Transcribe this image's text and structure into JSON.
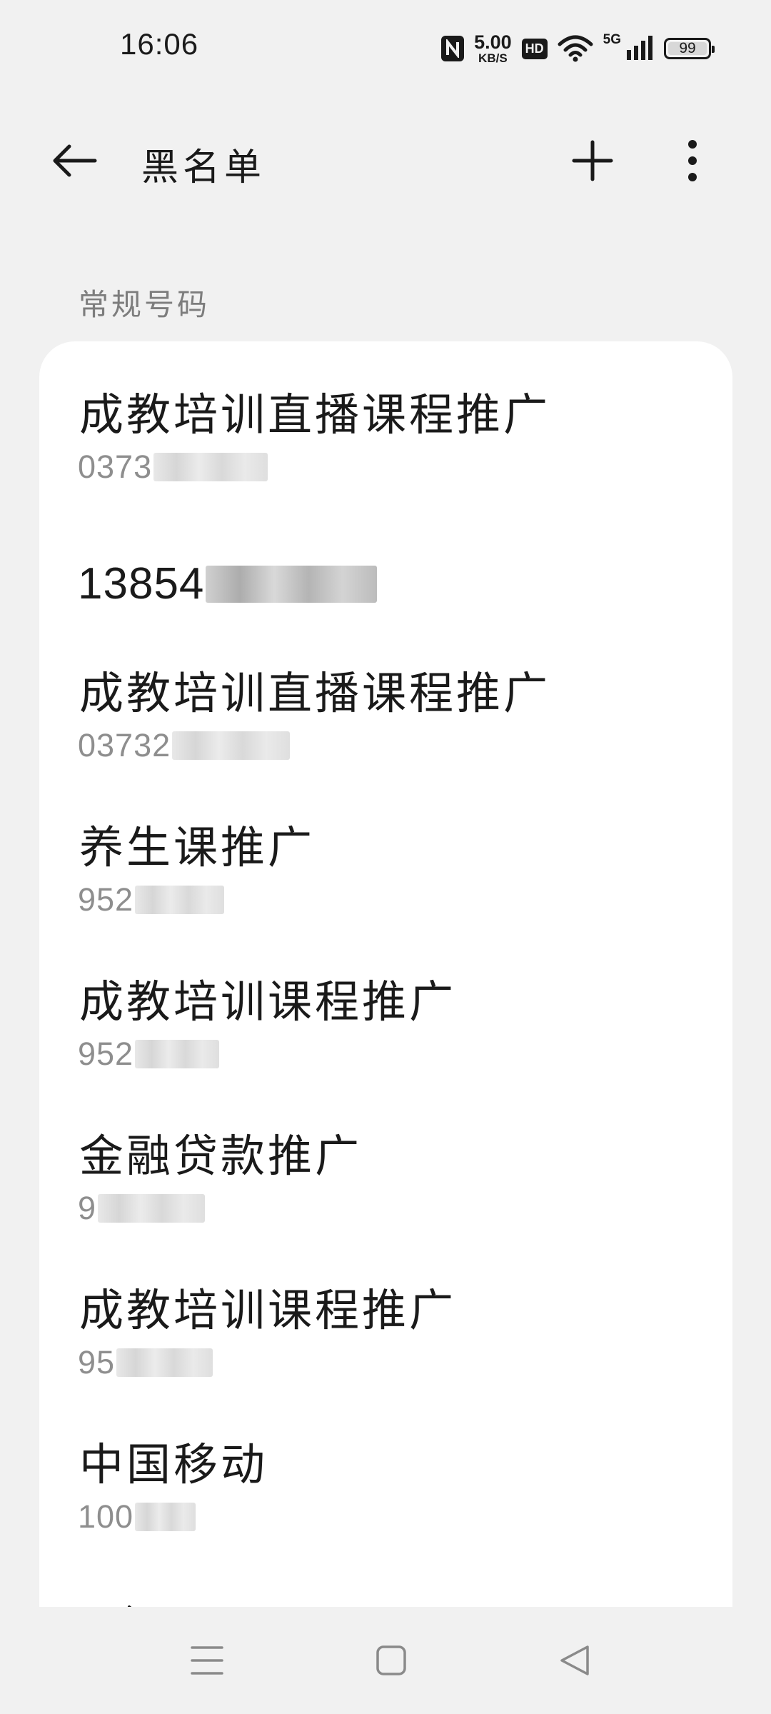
{
  "status_bar": {
    "time": "16:06",
    "net_speed_value": "5.00",
    "net_speed_unit": "KB/S",
    "hd_label": "HD",
    "signal_label": "5G",
    "battery_level": "99"
  },
  "app_bar": {
    "title": "黑名单"
  },
  "section": {
    "header": "常规号码"
  },
  "items": [
    {
      "name": "成教培训直播课程推广",
      "number_visible": "0373"
    },
    {
      "name": "",
      "number_visible": "13854"
    },
    {
      "name": "成教培训直播课程推广",
      "number_visible": "03732"
    },
    {
      "name": "养生课推广",
      "number_visible": "952"
    },
    {
      "name": "成教培训课程推广",
      "number_visible": "952"
    },
    {
      "name": "金融贷款推广",
      "number_visible": "9"
    },
    {
      "name": "成教培训课程推广",
      "number_visible": "95"
    },
    {
      "name": "中国移动",
      "number_visible": "100"
    }
  ],
  "icons": {
    "back": "arrow-left-icon",
    "add": "plus-icon",
    "more": "more-vertical-icon",
    "nav_menu": "menu-icon",
    "nav_home": "square-icon",
    "nav_back": "triangle-back-icon"
  },
  "colors": {
    "background": "#f1f1f1",
    "card": "#ffffff",
    "primary_text": "#1a1a1a",
    "secondary_text": "#8e8e8e"
  }
}
